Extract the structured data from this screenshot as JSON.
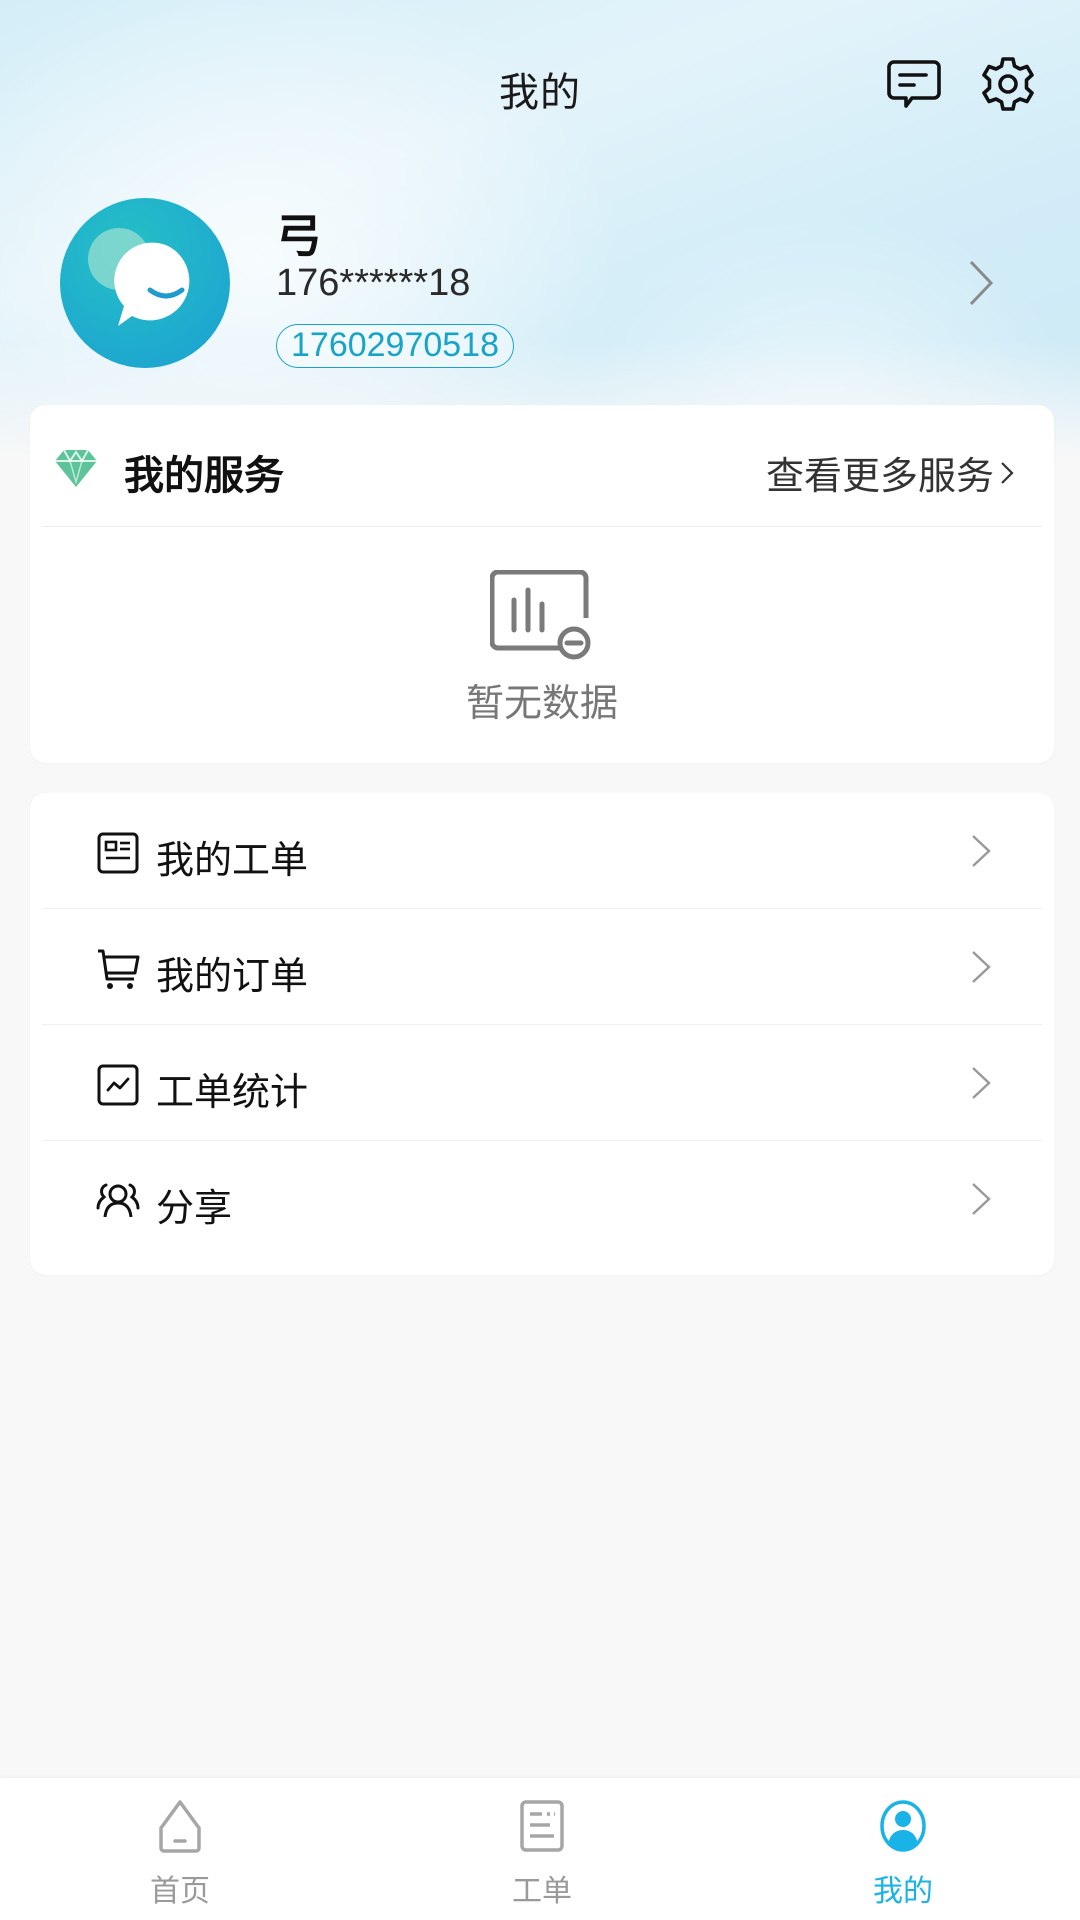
{
  "header": {
    "title": "我的",
    "message_icon": "message-icon",
    "settings_icon": "gear-icon"
  },
  "profile": {
    "name": "弓",
    "phone_masked": "176******18",
    "phone_full": "17602970518",
    "avatar_icon": "chat-bubble-smile-icon"
  },
  "services": {
    "title": "我的服务",
    "more_label": "查看更多服务",
    "empty_text": "暂无数据",
    "icon": "gem-icon"
  },
  "menu": {
    "items": [
      {
        "label": "我的工单",
        "icon": "work-order-icon"
      },
      {
        "label": "我的订单",
        "icon": "cart-icon"
      },
      {
        "label": "工单统计",
        "icon": "chart-trend-icon"
      },
      {
        "label": "分享",
        "icon": "users-icon"
      }
    ]
  },
  "tabbar": {
    "tabs": [
      {
        "label": "首页",
        "icon": "home-icon",
        "active": false
      },
      {
        "label": "工单",
        "icon": "document-icon",
        "active": false
      },
      {
        "label": "我的",
        "icon": "user-circle-icon",
        "active": true
      }
    ],
    "active_color": "#1ab3e8",
    "inactive_color": "#9a9a9a"
  },
  "colors": {
    "accent": "#1aa3c8",
    "gem": "#5cc39a"
  }
}
